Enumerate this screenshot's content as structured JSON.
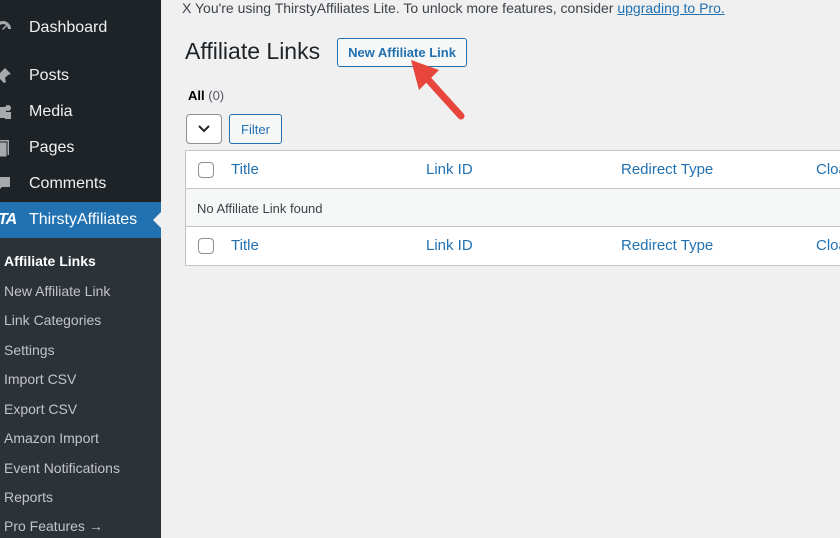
{
  "sidebar": {
    "items": [
      {
        "label": "Dashboard",
        "icon": "dashboard-icon"
      },
      {
        "label": "Posts",
        "icon": "pin-icon"
      },
      {
        "label": "Media",
        "icon": "media-icon"
      },
      {
        "label": "Pages",
        "icon": "pages-icon"
      },
      {
        "label": "Comments",
        "icon": "comment-icon"
      },
      {
        "label": "ThirstyAffiliates",
        "icon": "ta-logo",
        "logo_text": "TA"
      }
    ],
    "submenu": [
      "Affiliate Links",
      "New Affiliate Link",
      "Link Categories",
      "Settings",
      "Import CSV",
      "Export CSV",
      "Amazon Import",
      "Event Notifications",
      "Reports",
      "Pro Features →"
    ]
  },
  "notice": {
    "text": "X You're using ThirstyAffiliates Lite. To unlock more features, consider ",
    "link": "upgrading to Pro."
  },
  "page": {
    "title": "Affiliate Links",
    "add_new": "New Affiliate Link"
  },
  "filters": {
    "all_label": "All",
    "all_count": "(0)",
    "filter_button": "Filter"
  },
  "table": {
    "columns": [
      "Title",
      "Link ID",
      "Redirect Type",
      "Cloa"
    ],
    "empty_message": "No Affiliate Link found"
  },
  "colors": {
    "sidebar_bg": "#1d2327",
    "accent": "#2271b1",
    "arrow": "#e8453c"
  }
}
